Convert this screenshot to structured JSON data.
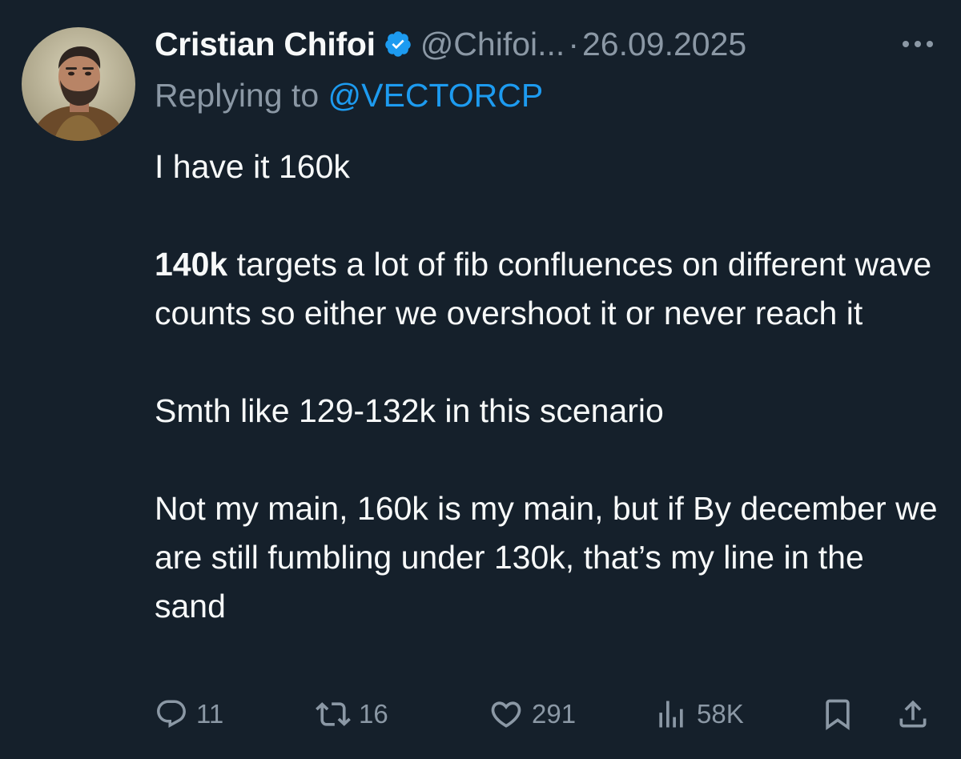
{
  "tweet": {
    "author_name": "Cristian Chifoi",
    "handle": "@Chifoi...",
    "separator": "·",
    "date": "26.09.2025",
    "replying_to_label": "Replying to",
    "replying_to_handle": "@VECTORCP",
    "body": {
      "p1": "I have it 160k",
      "p2_bold": "140k",
      "p2_rest": " targets a lot of fib confluences on different wave counts so either we overshoot it or never reach it",
      "p3": "Smth like 129-132k in this scenario",
      "p4": "Not my main, 160k is my main, but if By december we are still fumbling under 130k, that’s my line in the sand"
    }
  },
  "actions": {
    "replies": "11",
    "retweets": "16",
    "likes": "291",
    "views": "58K"
  },
  "icons": {
    "verified": "verified-badge-icon",
    "more": "more-icon",
    "reply": "reply-icon",
    "retweet": "retweet-icon",
    "like": "heart-icon",
    "views": "views-icon",
    "bookmark": "bookmark-icon",
    "share": "share-icon"
  },
  "colors": {
    "background": "#15202b",
    "text": "#f7f9f9",
    "secondary": "#8b98a5",
    "accent": "#1d9bf0"
  }
}
